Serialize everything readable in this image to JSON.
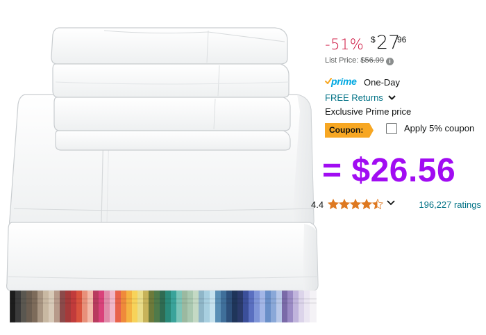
{
  "product": {
    "image_alt_name": "sheet-set-image"
  },
  "price": {
    "discount": "-51%",
    "currency_symbol": "$",
    "whole": "27",
    "fraction": "96",
    "list_price_label": "List Price: ",
    "list_price_value": "$56.99",
    "info_icon": "info-icon"
  },
  "delivery": {
    "prime_label": "prime",
    "prime_speed": "One-Day",
    "returns_label": "FREE Returns",
    "exclusive_label": "Exclusive Prime price"
  },
  "coupon": {
    "badge_label": "Coupon:",
    "apply_label": "Apply 5% coupon",
    "checked": false
  },
  "final_price": "= $26.56",
  "rating": {
    "value": "4.4",
    "stars": 4.4,
    "count_label": "196,227 ratings"
  },
  "colors": {
    "discount": "#cc0c39",
    "link": "#007185",
    "prime": "#00a8e1",
    "coupon_badge": "#f7a723",
    "final_price": "#a10cf2",
    "star": "#de7921"
  }
}
